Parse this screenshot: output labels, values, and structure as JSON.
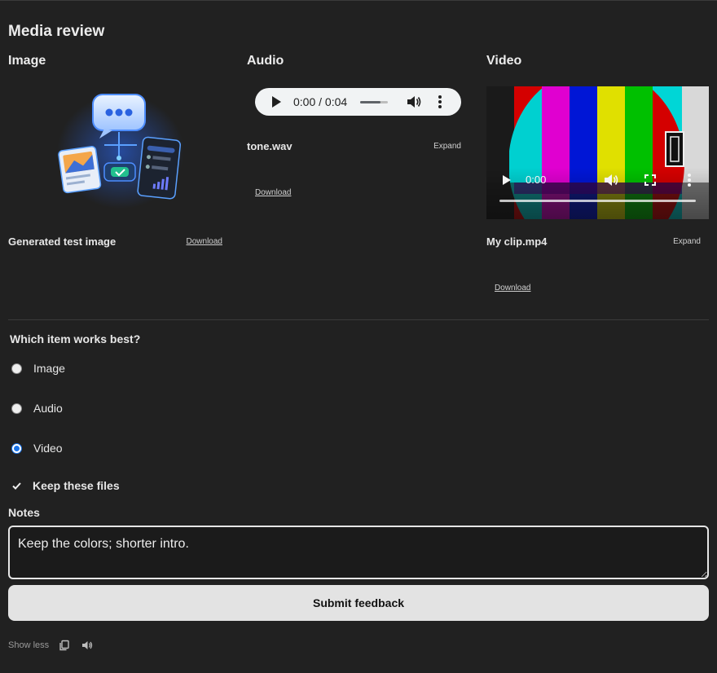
{
  "page": {
    "title": "Media review"
  },
  "image_panel": {
    "heading": "Image",
    "caption": "Generated test image",
    "download_label": "Download"
  },
  "audio_panel": {
    "heading": "Audio",
    "player": {
      "time": "0:00 / 0:04",
      "volume_level": 0.7
    },
    "file_name": "tone.wav",
    "expand_label": "Expand",
    "download_label": "Download"
  },
  "video_panel": {
    "heading": "Video",
    "player": {
      "time": "0:00"
    },
    "file_name": "My clip.mp4",
    "expand_label": "Expand",
    "download_label": "Download"
  },
  "question": {
    "label": "Which item works best?",
    "options": [
      {
        "label": "Image",
        "selected": false
      },
      {
        "label": "Audio",
        "selected": false
      },
      {
        "label": "Video",
        "selected": true
      }
    ]
  },
  "keep_files": {
    "label": "Keep these files",
    "checked": true
  },
  "notes": {
    "label": "Notes",
    "value": "Keep the colors; shorter intro."
  },
  "submit": {
    "label": "Submit feedback"
  },
  "footer": {
    "show_less_label": "Show less",
    "icons": [
      "copy-icon",
      "speaker-icon"
    ]
  },
  "colors": {
    "background": "#212121",
    "accent": "#1a73e8",
    "button_bg": "#e3e3e3"
  }
}
